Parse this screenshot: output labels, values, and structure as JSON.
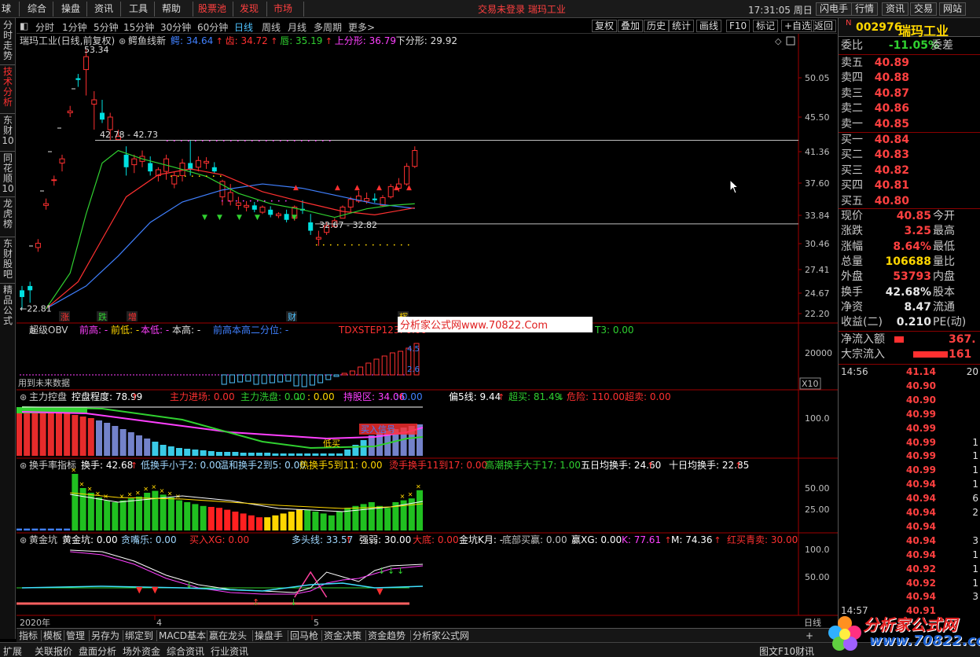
{
  "menubar": {
    "items": [
      "球",
      "综合",
      "操盘",
      "资讯",
      "工具",
      "帮助",
      "股票池",
      "发现",
      "市场"
    ],
    "red_items": [
      "股票池",
      "发现",
      "市场"
    ],
    "center_text": "交易未登录  瑞玛工业",
    "toolbar_buttons": [
      "复权",
      "叠加",
      "历史",
      "统计",
      "画线",
      "F10",
      "标记",
      "+自选",
      "返回"
    ],
    "clock": "17:31:05 周日",
    "right_buttons": [
      "闪电手",
      "行情",
      "资讯",
      "交易",
      "网站"
    ]
  },
  "left_nav": [
    {
      "label": "分时走势",
      "active": false
    },
    {
      "label": "技术分析",
      "active": true
    },
    {
      "label": "东财10",
      "active": false
    },
    {
      "label": "同花顺10",
      "active": false
    },
    {
      "label": "龙虎榜",
      "active": false
    },
    {
      "label": "东财股吧",
      "active": false
    },
    {
      "label": "精品公式",
      "active": false
    }
  ],
  "period_tabs": [
    "分时",
    "1分钟",
    "5分钟",
    "15分钟",
    "30分钟",
    "60分钟",
    "日线",
    "周线",
    "月线",
    "多周期",
    "更多>"
  ],
  "active_period": "日线",
  "main_panel": {
    "title": "瑞玛工业(日线,前复权)",
    "indicator_name": "鳄鱼线新",
    "indicators": [
      {
        "label": "鳄: 34.64",
        "color": "#4080ff",
        "arrow": "up"
      },
      {
        "label": "齿: 34.72",
        "color": "#ff3030",
        "arrow": "up"
      },
      {
        "label": "唇: 35.19",
        "color": "#30d030",
        "arrow": "up"
      },
      {
        "label": "上分形: 36.79",
        "color": "#ff40ff",
        "arrow": ""
      },
      {
        "label": "下分形: 29.92",
        "color": "#e0e0e0",
        "arrow": ""
      }
    ],
    "y_ticks": [
      "50.05",
      "45.50",
      "41.36",
      "37.60",
      "33.84",
      "30.46",
      "27.41",
      "24.67",
      "22.20"
    ],
    "annotations": [
      "53.34",
      "42.78 - 42.73",
      "32.67 - 32.82",
      "22.81"
    ],
    "event_labels": [
      "涨",
      "跌",
      "增",
      "财",
      "辉"
    ]
  },
  "obv_panel": {
    "name": "超级OBV",
    "fields": [
      {
        "label": "前高: -",
        "color": "#ff40ff"
      },
      {
        "label": "前低: -",
        "color": "#ffd700"
      },
      {
        "label": "本低: -",
        "color": "#ff40ff"
      },
      {
        "label": "本高: -",
        "color": "#e0e0e0"
      },
      {
        "label": "前高本高二分位: -",
        "color": "#4080ff"
      },
      {
        "label": "TDXSTEP123: 0.00",
        "color": "#ff3030"
      },
      {
        "label": "T3: 0.00",
        "color": "#30d030"
      }
    ],
    "note": "用到未来数据",
    "y_tick": "20000",
    "scale_tag": "X10",
    "side_labels": [
      "4.5",
      "2.6"
    ],
    "watermark": "分析家公式网www.70822.Com"
  },
  "control_panel": {
    "name": "主力控盘",
    "fields": [
      {
        "label": "控盘程度: 78.99",
        "color": "#ffffff",
        "arrow": "up"
      },
      {
        "label": "主力进场: 0.00",
        "color": "#ff3030",
        "arrow": ""
      },
      {
        "label": "主力洗盘: 0.00",
        "color": "#30d030",
        "arrow": "down"
      },
      {
        "label": ": 0.00",
        "color": "#ffd700",
        "arrow": ""
      },
      {
        "label": "持股区: 34.06",
        "color": "#ff40ff",
        "arrow": "up"
      },
      {
        "label": ": 0.00",
        "color": "#4080ff",
        "arrow": ""
      },
      {
        "label": "偏5线: 9.44",
        "color": "#ffffff",
        "arrow": "up"
      },
      {
        "label": "超买: 81.49",
        "color": "#30d030",
        "arrow": "down"
      },
      {
        "label": "危险: 110.00",
        "color": "#ff3030",
        "arrow": ""
      },
      {
        "label": "超卖: 0.00",
        "color": "#ff3030",
        "arrow": ""
      }
    ],
    "y_tick": "100.0",
    "inline_labels": [
      "低买",
      "买入信号"
    ]
  },
  "turnover_panel": {
    "name": "换手率指标",
    "fields": [
      {
        "label": "换手: 42.68",
        "color": "#ffffff",
        "arrow": "up"
      },
      {
        "label": "低换手小于2: 0.00",
        "color": "#a0d8ff",
        "arrow": ""
      },
      {
        "label": "温和换手2到5: 0.00",
        "color": "#a0d8ff",
        "arrow": ""
      },
      {
        "label": "热换手5到11: 0.00",
        "color": "#ffd700",
        "arrow": ""
      },
      {
        "label": "烫手换手11到17: 0.00",
        "color": "#ff3030",
        "arrow": ""
      },
      {
        "label": "高潮换手大于17: 1.00",
        "color": "#30d030",
        "arrow": ""
      },
      {
        "label": "五日均换手: 24.60",
        "color": "#ffffff",
        "arrow": "up"
      },
      {
        "label": "十日均换手: 22.85",
        "color": "#ffffff",
        "arrow": "up"
      }
    ],
    "y_ticks": [
      "50.00",
      "25.00"
    ]
  },
  "gold_panel": {
    "name": "黄金坑",
    "fields": [
      {
        "label": "黄金坑: 0.00",
        "color": "#ffffff",
        "arrow": ""
      },
      {
        "label": "贪嘴乐: 0.00",
        "color": "#a0d8ff",
        "arrow": ""
      },
      {
        "label": "买入XG: 0.00",
        "color": "#ff3030",
        "arrow": ""
      },
      {
        "label": "多头线: 33.57",
        "color": "#a0d8ff",
        "arrow": "up"
      },
      {
        "label": "强弱: 30.00",
        "color": "#ffffff",
        "arrow": ""
      },
      {
        "label": "大底: 0.00",
        "color": "#ff3030",
        "arrow": ""
      },
      {
        "label": "金坑K月: -",
        "color": "#ffffff",
        "arrow": ""
      },
      {
        "label": "底部买赢: 0.00",
        "color": "#c0c0c0",
        "arrow": ""
      },
      {
        "label": "赢XG: 0.00",
        "color": "#ffffff",
        "arrow": ""
      },
      {
        "label": "K: 77.61",
        "color": "#ff40ff",
        "arrow": "up"
      },
      {
        "label": "M: 74.36",
        "color": "#ffffff",
        "arrow": "up"
      },
      {
        "label": "红买青卖: 30.00",
        "color": "#ff3030",
        "arrow": ""
      }
    ],
    "y_ticks": [
      "100.0",
      "50.00"
    ]
  },
  "date_axis": [
    "2020年",
    "4",
    "5"
  ],
  "date_axis_right": "日线",
  "bottom_tabs": [
    "指标",
    "模板",
    "管理",
    "另存为",
    "绑定到",
    "MACD基本",
    "嬴在龙头",
    "操盘手",
    "回马枪",
    "资金决策",
    "资金趋势",
    "分析家公式网"
  ],
  "bottom_plus": "+",
  "status_bar": [
    "扩展",
    "关联报价",
    "盘面分析",
    "场外资金",
    "综合资讯",
    "行业资讯",
    "图文F10",
    "财讯"
  ],
  "quote": {
    "code": "002976",
    "name": "瑞玛工业",
    "weibi_label": "委比",
    "weibi": "-11.05%",
    "weicha_label": "委差",
    "asks": [
      {
        "label": "卖五",
        "price": "40.89"
      },
      {
        "label": "卖四",
        "price": "40.88"
      },
      {
        "label": "卖三",
        "price": "40.87"
      },
      {
        "label": "卖二",
        "price": "40.86"
      },
      {
        "label": "卖一",
        "price": "40.85"
      }
    ],
    "bids": [
      {
        "label": "买一",
        "price": "40.84"
      },
      {
        "label": "买二",
        "price": "40.83"
      },
      {
        "label": "买三",
        "price": "40.82"
      },
      {
        "label": "买四",
        "price": "40.81"
      },
      {
        "label": "买五",
        "price": "40.80"
      }
    ],
    "stats": [
      {
        "l1": "现价",
        "v1": "40.85",
        "l2": "今开"
      },
      {
        "l1": "涨跌",
        "v1": "3.25",
        "l2": "最高"
      },
      {
        "l1": "涨幅",
        "v1": "8.64%",
        "l2": "最低"
      },
      {
        "l1": "总量",
        "v1": "106688",
        "l2": "量比"
      },
      {
        "l1": "外盘",
        "v1": "53793",
        "l2": "内盘"
      },
      {
        "l1": "换手",
        "v1": "42.68%",
        "l2": "股本"
      },
      {
        "l1": "净资",
        "v1": "8.47",
        "l2": "流通"
      },
      {
        "l1": "收益(二)",
        "v1": "0.210",
        "l2": "PE(动)"
      }
    ],
    "flows": [
      {
        "label": "净流入额",
        "value": "367."
      },
      {
        "label": "大宗流入",
        "value": "161"
      }
    ],
    "ticks": [
      {
        "time": "14:56",
        "price": "41.14",
        "vol": "20"
      },
      {
        "time": "",
        "price": "40.90",
        "vol": ""
      },
      {
        "time": "",
        "price": "40.90",
        "vol": ""
      },
      {
        "time": "",
        "price": "40.99",
        "vol": ""
      },
      {
        "time": "",
        "price": "40.99",
        "vol": ""
      },
      {
        "time": "",
        "price": "40.99",
        "vol": "1"
      },
      {
        "time": "",
        "price": "40.99",
        "vol": "1"
      },
      {
        "time": "",
        "price": "40.99",
        "vol": "1"
      },
      {
        "time": "",
        "price": "40.94",
        "vol": "1"
      },
      {
        "time": "",
        "price": "40.94",
        "vol": "6"
      },
      {
        "time": "",
        "price": "40.94",
        "vol": "2"
      },
      {
        "time": "",
        "price": "40.94",
        "vol": ""
      },
      {
        "time": "",
        "price": "40.94",
        "vol": "3"
      },
      {
        "time": "",
        "price": "40.94",
        "vol": "1"
      },
      {
        "time": "",
        "price": "40.92",
        "vol": "1"
      },
      {
        "time": "",
        "price": "40.92",
        "vol": "1"
      },
      {
        "time": "",
        "price": "40.94",
        "vol": "3"
      },
      {
        "time": "14:57",
        "price": "40.91",
        "vol": ""
      }
    ]
  },
  "brand_watermark": {
    "title": "分析家公式网",
    "url": "www.70822.com"
  },
  "colors": {
    "up": "#ff3030",
    "down": "#00d0d0",
    "green": "#30d030",
    "blue": "#4080ff",
    "accent": "#4fc3ff"
  }
}
